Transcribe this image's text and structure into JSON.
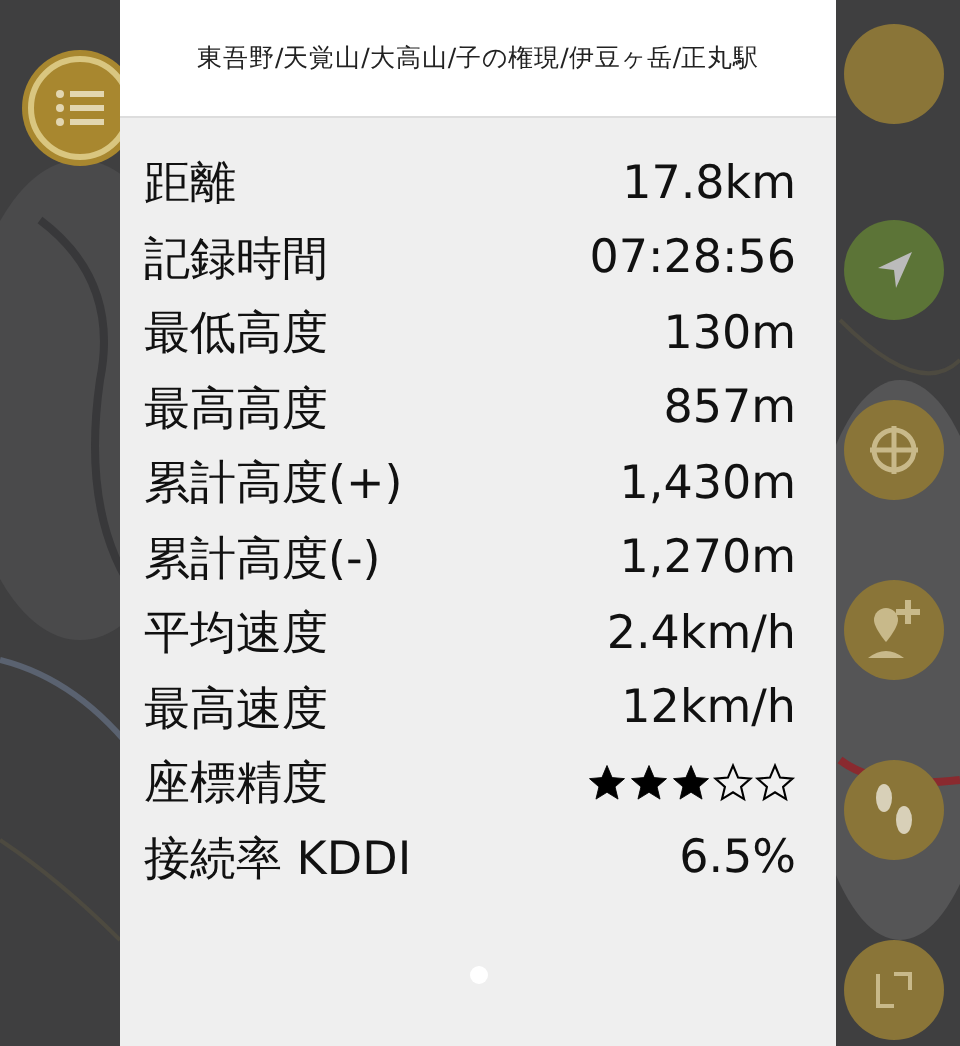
{
  "route_title": "東吾野/天覚山/大高山/子の権現/伊豆ヶ岳/正丸駅",
  "stats": [
    {
      "kind": "text",
      "label": "距離",
      "value": "17.8km"
    },
    {
      "kind": "text",
      "label": "記録時間",
      "value": "07:28:56"
    },
    {
      "kind": "text",
      "label": "最低高度",
      "value": "130m"
    },
    {
      "kind": "text",
      "label": "最高高度",
      "value": "857m"
    },
    {
      "kind": "text",
      "label": "累計高度(+)",
      "value": "1,430m"
    },
    {
      "kind": "text",
      "label": "累計高度(-)",
      "value": "1,270m"
    },
    {
      "kind": "text",
      "label": "平均速度",
      "value": "2.4km/h"
    },
    {
      "kind": "text",
      "label": "最高速度",
      "value": "12km/h"
    },
    {
      "kind": "stars",
      "label": "座標精度",
      "stars": 3
    },
    {
      "kind": "text",
      "label": "接続率 KDDI",
      "value": "6.5%"
    }
  ],
  "pages": [
    {
      "selected": true
    }
  ]
}
